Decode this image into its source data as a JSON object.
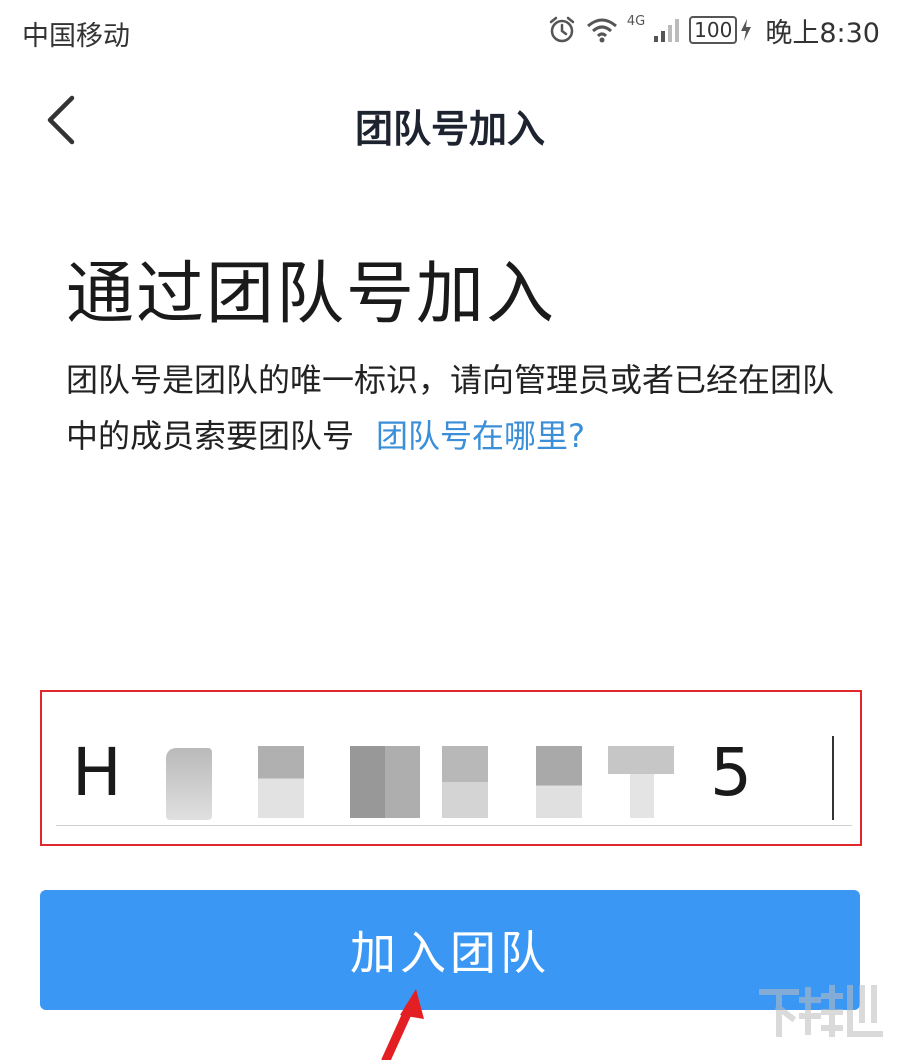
{
  "status": {
    "carrier": "中国移动",
    "network": "4G",
    "battery": "100",
    "time": "晚上8:30"
  },
  "nav": {
    "title": "团队号加入"
  },
  "content": {
    "heading": "通过团队号加入",
    "description": "团队号是团队的唯一标识，请向管理员或者已经在团队中的成员索要团队号",
    "help_link": "团队号在哪里?"
  },
  "code_input": {
    "first_char": "H",
    "last_char": "5"
  },
  "join_button": {
    "label": "加入团队"
  },
  "icons": {
    "back": "chevron-left-icon",
    "alarm": "alarm-icon",
    "wifi": "wifi-icon",
    "signal": "signal-icon",
    "charging": "charging-icon"
  },
  "colors": {
    "accent": "#3b97f4",
    "link": "#3a8fd8",
    "highlight": "#e0272b"
  }
}
